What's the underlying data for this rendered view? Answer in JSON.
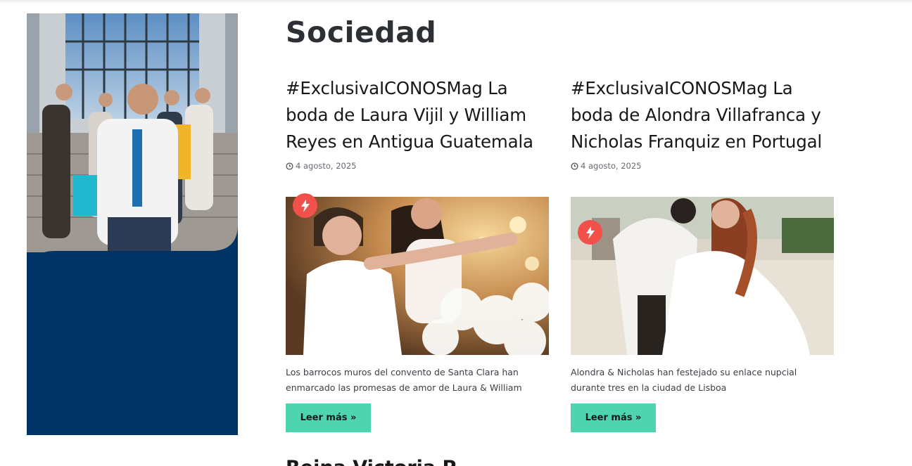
{
  "section": {
    "title": "Sociedad"
  },
  "posts": [
    {
      "title": "#ExclusivaICONOSMag La boda de Laura Vijil y William Reyes en Antigua Guatemala",
      "date": "4 agosto, 2025",
      "excerpt": "Los barrocos muros del convento de Santa Clara han enmarcado las promesas de amor de Laura & William",
      "read_more": "Leer más »",
      "badge_icon": "bolt-icon"
    },
    {
      "title": "#ExclusivaICONOSMag La boda de Alondra Villafranca y Nicholas Franquiz en Portugal",
      "date": "4 agosto, 2025",
      "excerpt": "Alondra & Nicholas han festejado su enlace nupcial durante tres en la ciudad de Lisboa",
      "read_more": "Leer más »",
      "badge_icon": "bolt-icon"
    }
  ],
  "next_post": {
    "title_partial": "Reina Victoria P..."
  },
  "colors": {
    "accent_button": "#4fd4b0",
    "badge": "#f2504b",
    "ad_navy": "#003366"
  }
}
